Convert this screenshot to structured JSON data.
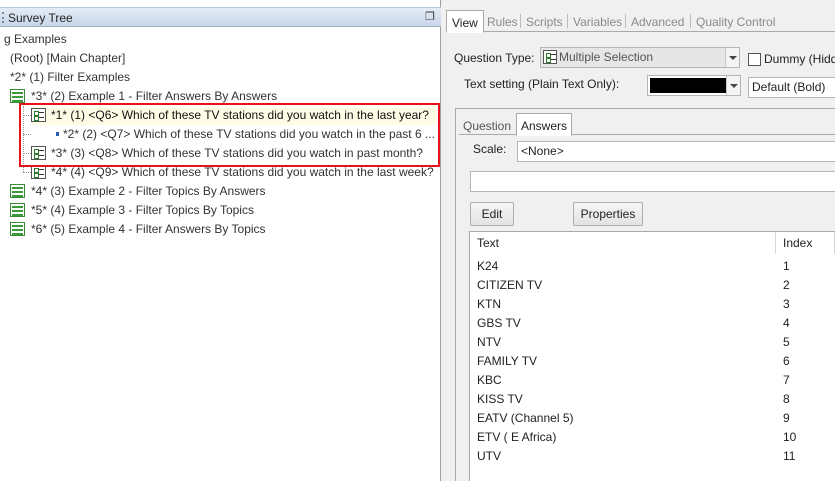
{
  "tree": {
    "header_title": "Survey Tree",
    "pin_glyph": "❐",
    "items": [
      {
        "text": "g Examples"
      },
      {
        "text": "(Root) [Main Chapter]"
      },
      {
        "text": "*2* (1) Filter Examples"
      },
      {
        "text": "*3* (2) Example 1 - Filter Answers By Answers"
      },
      {
        "text": "*1* (1) <Q6> Which of these TV stations did you watch in the last year?"
      },
      {
        "text": "*2* (2) <Q7> Which of these TV stations did you watch in the past 6 ..."
      },
      {
        "text": "*3* (3) <Q8> Which of these TV stations did you watch in past month?"
      },
      {
        "text": "*4* (4) <Q9> Which of these TV stations did you watch in the last week?"
      },
      {
        "text": "*4* (3) Example 2 - Filter Topics By Answers"
      },
      {
        "text": "*5* (4) Example 3 - Filter Topics By Topics"
      },
      {
        "text": "*6* (5) Example 4 - Filter Answers By Topics"
      }
    ]
  },
  "tabs": [
    "View",
    "Rules",
    "Scripts",
    "Variables",
    "Advanced",
    "Quality Control"
  ],
  "question_type": {
    "label": "Question Type:",
    "value": "Multiple Selection"
  },
  "dummy": {
    "label": "Dummy (Hidd"
  },
  "text_setting": {
    "label": "Text setting (Plain Text Only):",
    "style_value": "Default (Bold)",
    "color_value": "#000000"
  },
  "inner_tabs": [
    "Question",
    "Answers"
  ],
  "scale": {
    "label": "Scale:",
    "value": "<None>"
  },
  "buttons": {
    "edit": "Edit",
    "properties": "Properties"
  },
  "grid": {
    "columns": [
      "Text",
      "Index"
    ],
    "rows": [
      {
        "text": "K24",
        "index": "1"
      },
      {
        "text": "CITIZEN TV",
        "index": "2"
      },
      {
        "text": "KTN",
        "index": "3"
      },
      {
        "text": "GBS TV",
        "index": "4"
      },
      {
        "text": "NTV",
        "index": "5"
      },
      {
        "text": "FAMILY TV",
        "index": "6"
      },
      {
        "text": "KBC",
        "index": "7"
      },
      {
        "text": "KISS TV",
        "index": "8"
      },
      {
        "text": "EATV (Channel 5)",
        "index": "9"
      },
      {
        "text": "ETV ( E Africa)",
        "index": "10"
      },
      {
        "text": "UTV",
        "index": "11"
      }
    ]
  },
  "colors": {
    "highlight": "#e8101a",
    "header_bg": "#c8d6e8"
  }
}
